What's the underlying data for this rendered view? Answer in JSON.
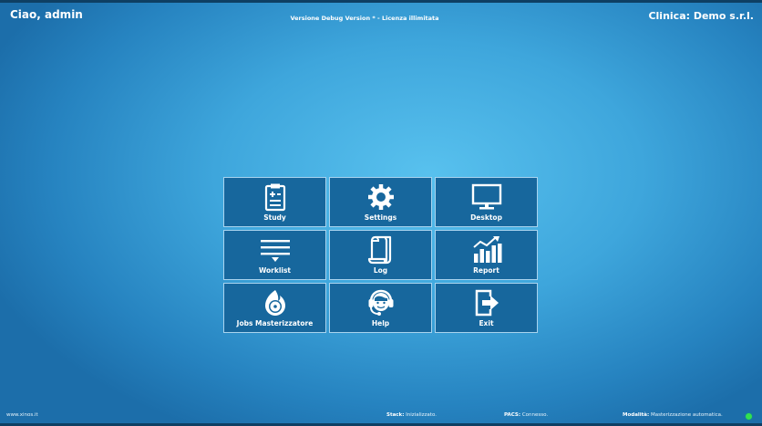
{
  "header": {
    "greeting": "Ciao, admin",
    "version_text": "Versione Debug Version * - Licenza illimitata",
    "clinic": "Clinica: Demo s.r.l."
  },
  "menu": {
    "tiles": [
      {
        "label": "Study",
        "icon": "clipboard-icon"
      },
      {
        "label": "Settings",
        "icon": "gear-icon"
      },
      {
        "label": "Desktop",
        "icon": "monitor-icon"
      },
      {
        "label": "Worklist",
        "icon": "list-icon"
      },
      {
        "label": "Log",
        "icon": "scroll-icon"
      },
      {
        "label": "Report",
        "icon": "bar-chart-icon"
      },
      {
        "label": "Jobs Masterizzatore",
        "icon": "disc-burner-icon"
      },
      {
        "label": "Help",
        "icon": "headset-icon"
      },
      {
        "label": "Exit",
        "icon": "exit-door-icon"
      }
    ]
  },
  "footer": {
    "website": "www.xinos.it",
    "stack_label": "Stack:",
    "stack_value": "Inizializzato.",
    "pacs_label": "PACS:",
    "pacs_value": "Connesso.",
    "mode_label": "Modalità:",
    "mode_value": "Masterizzazione automatica.",
    "status_color": "#33e04f"
  },
  "colors": {
    "tile_bg": "#17679d",
    "tile_border": "#a9d4ef",
    "background": "#3ea6dc"
  }
}
